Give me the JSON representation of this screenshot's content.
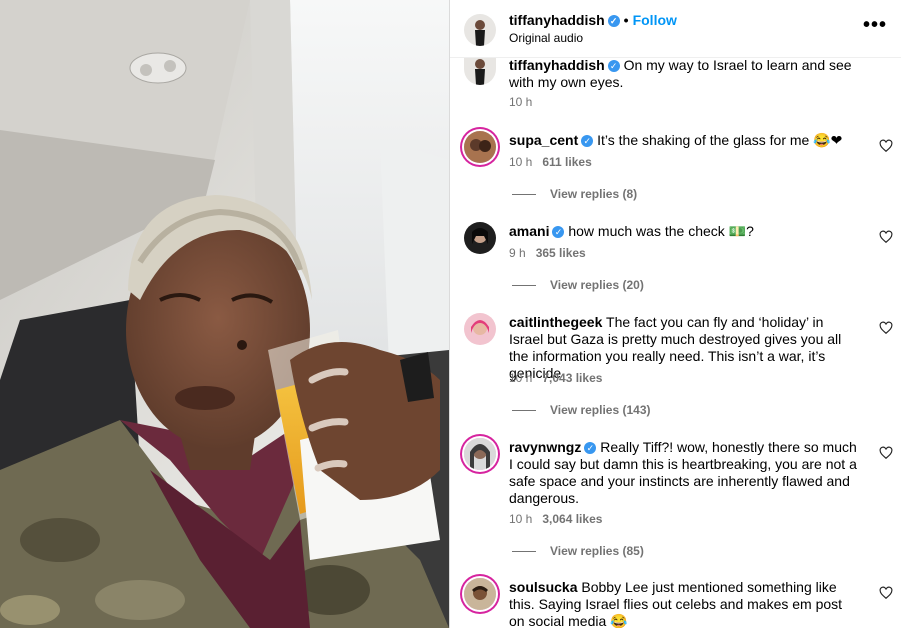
{
  "post": {
    "username": "tiffanyhaddish",
    "verified": true,
    "follow_label": "Follow",
    "separator": "•",
    "audio": "Original audio",
    "more_label": "•••"
  },
  "caption": {
    "username": "tiffanyhaddish",
    "text": "On my way to Israel to learn and see with my own eyes.",
    "time": "10 h"
  },
  "comments": [
    {
      "username": "supa_cent",
      "verified": true,
      "text": "It’s the shaking of the glass for me 😂❤",
      "time": "10 h",
      "likes": "611 likes",
      "replies": "View replies (8)"
    },
    {
      "username": "amani",
      "verified": true,
      "text": "how much was the check 💵?",
      "time": "9 h",
      "likes": "365 likes",
      "replies": "View replies (20)"
    },
    {
      "username": "caitlinthegeek",
      "verified": false,
      "text": "The fact you can fly and ‘holiday’ in Israel but Gaza is pretty much destroyed gives you all the information you really need. This isn’t a war, it’s genicide",
      "time": "10 h",
      "likes": "7,043 likes",
      "replies": "View replies (143)"
    },
    {
      "username": "ravynwngz",
      "verified": true,
      "text": "Really Tiff?! wow, honestly there so much I could say but damn this is heartbreaking, you are not a safe space and your instincts are inherently flawed and dangerous.",
      "time": "10 h",
      "likes": "3,064 likes",
      "replies": "View replies (85)"
    },
    {
      "username": "soulsucka",
      "verified": false,
      "text": "Bobby Lee just mentioned something like this. Saying Israel flies out celebs and makes em post on social media 😂",
      "time": "",
      "likes": "",
      "replies": ""
    }
  ],
  "colors": {
    "link": "#0095f6",
    "verified": "#3897f0",
    "muted": "#737373"
  }
}
